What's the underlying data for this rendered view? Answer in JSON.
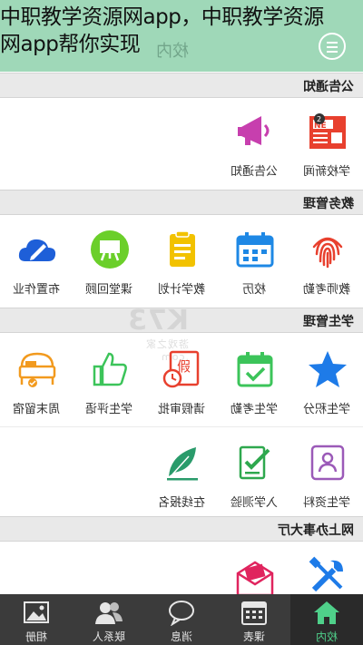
{
  "caption": {
    "line1": "中职教学资源网app，中职教学资源",
    "line2": "网app帮你实现"
  },
  "header": {
    "title": "校内"
  },
  "sections": {
    "notice": "公告通知",
    "teaching": "教务管理",
    "student": "学生管理",
    "office": "网上办事大厅"
  },
  "tiles": {
    "school_news": "学校新闻",
    "announcement": "公告通知",
    "teacher_attendance": "教师考勤",
    "calendar": "校历",
    "teaching_plan": "教学计划",
    "classroom_review": "课堂回顾",
    "homework": "布置作业",
    "student_points": "学生积分",
    "student_attendance": "学生考勤",
    "leave_approval": "请假审批",
    "student_evaluation": "学生评语",
    "weekend_stay": "周末留宿",
    "student_profile": "学生资料",
    "admission_test": "入学测验",
    "online_signup": "在线报名"
  },
  "watermark": {
    "brand": "K73",
    "sub": "游戏之家",
    "domain": ".com"
  },
  "tabs": {
    "home": "校内",
    "schedule": "课表",
    "messages": "消息",
    "contacts": "联系人",
    "album": "相册"
  },
  "colors": {
    "header": "#9fd8b8",
    "tabbar": "#3b3b3b",
    "active_tab": "#4fd08a",
    "red": "#e8402e",
    "blue": "#1e88e5",
    "green": "#3cc45a",
    "yellow": "#f2c200",
    "orange": "#f29a1e",
    "teal": "#2a9b6b",
    "purple": "#9b5ab8",
    "pink": "#e0245e"
  }
}
